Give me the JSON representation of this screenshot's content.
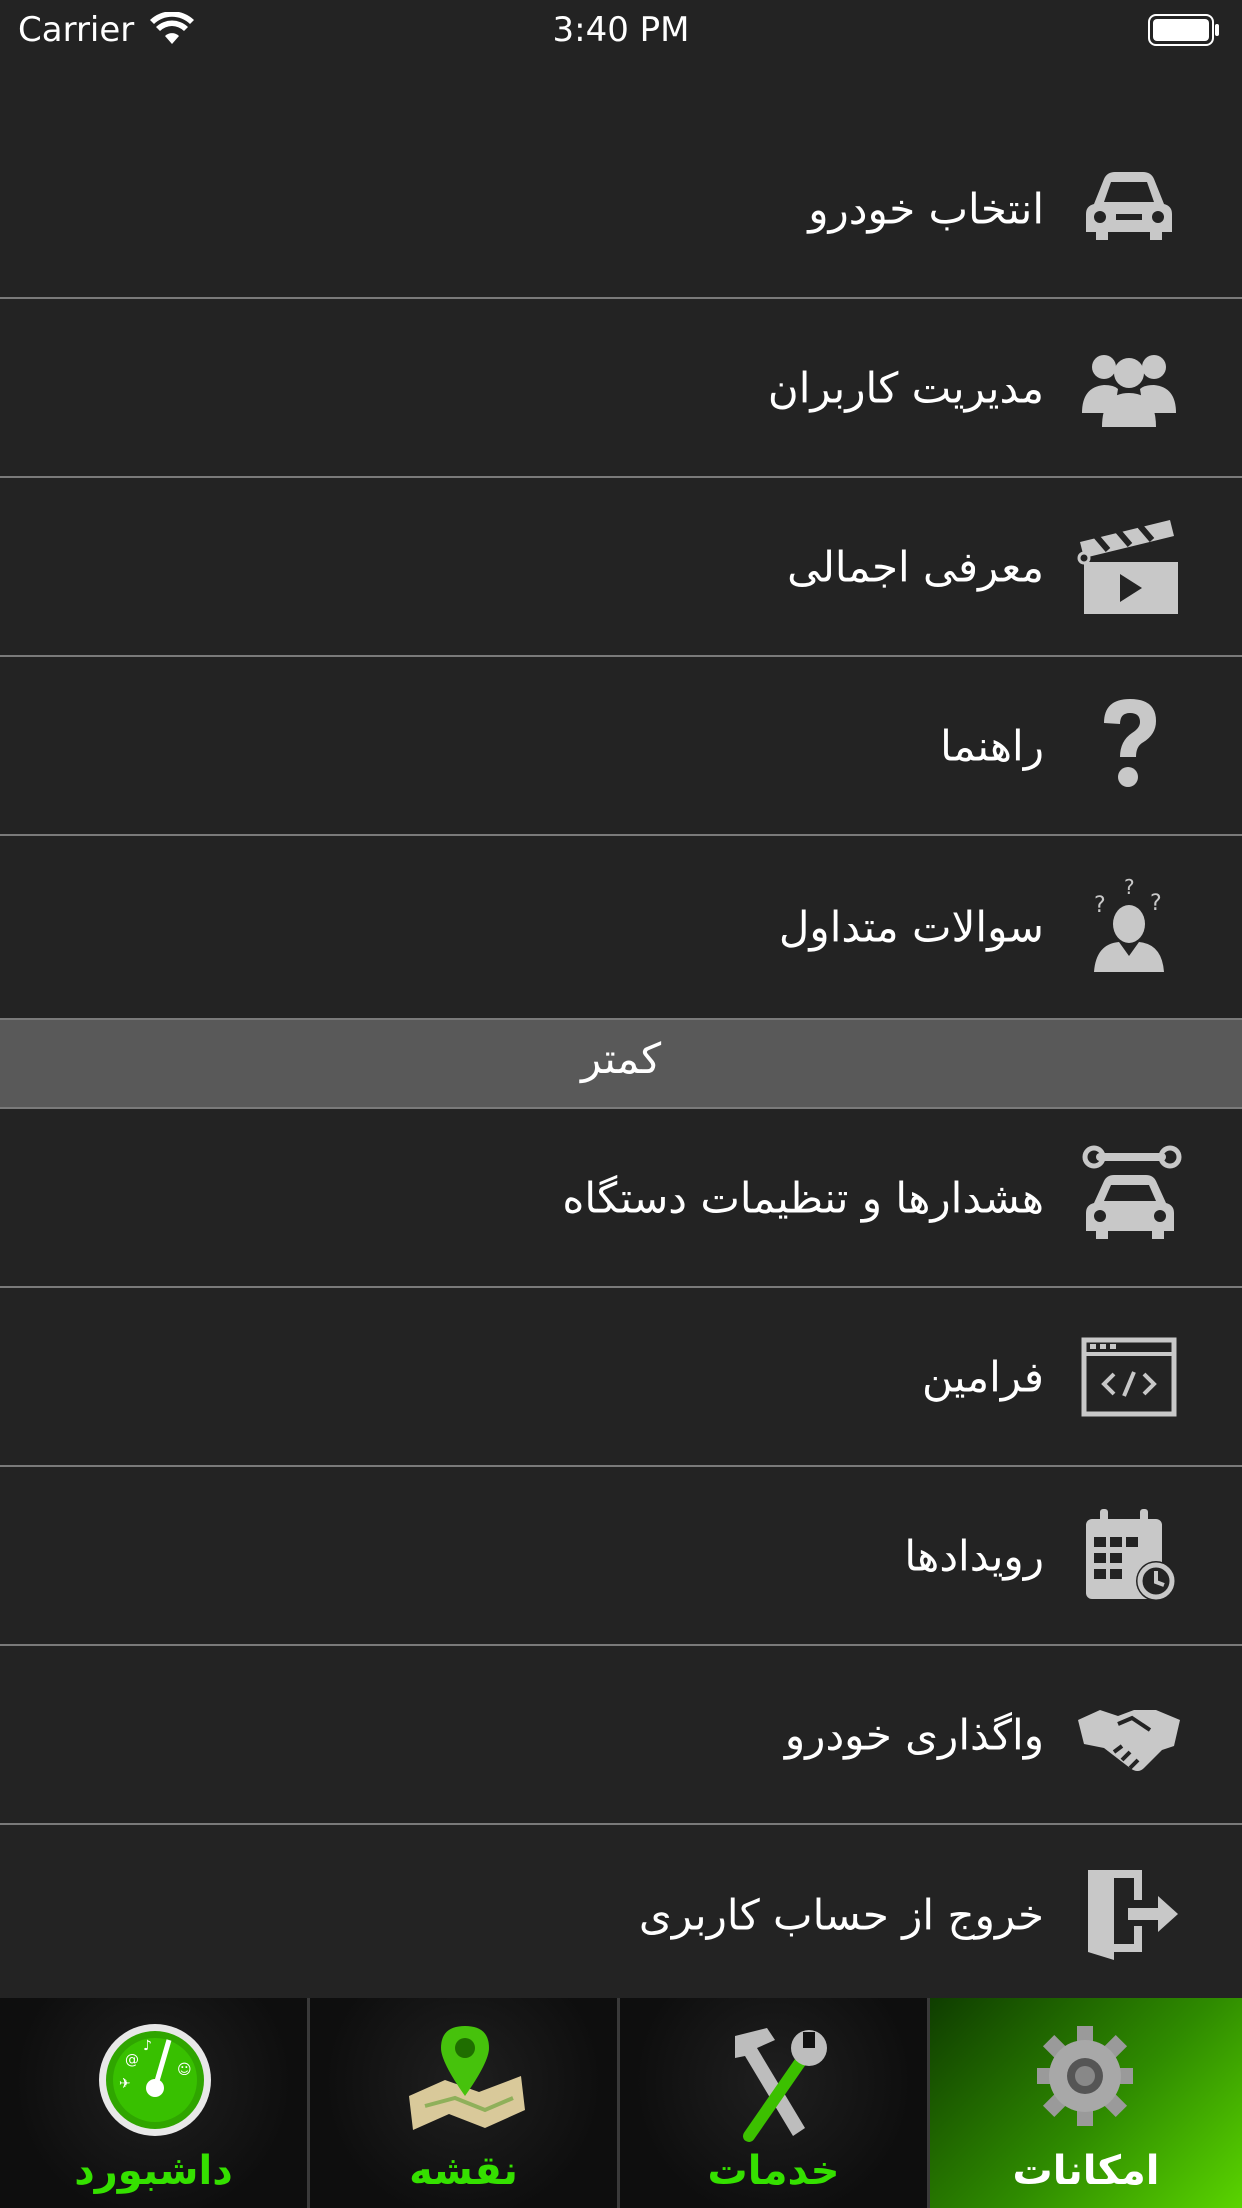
{
  "status_bar": {
    "carrier": "Carrier",
    "time": "3:40 PM"
  },
  "menu": {
    "items": [
      {
        "label": "انتخاب خودرو",
        "icon": "car-icon"
      },
      {
        "label": "مدیریت کاربران",
        "icon": "users-icon"
      },
      {
        "label": "معرفی اجمالی",
        "icon": "clapperboard-icon"
      },
      {
        "label": "راهنما",
        "icon": "question-icon"
      },
      {
        "label": "سوالات متداول",
        "icon": "faq-person-icon"
      }
    ],
    "section_header": "کمتر",
    "more_items": [
      {
        "label": "هشدارها و تنظیمات دستگاه",
        "icon": "car-wrench-icon"
      },
      {
        "label": "فرامین",
        "icon": "code-window-icon"
      },
      {
        "label": "رویدادها",
        "icon": "calendar-clock-icon"
      },
      {
        "label": "واگذاری خودرو",
        "icon": "handshake-icon"
      },
      {
        "label": "خروج از حساب کاربری",
        "icon": "logout-door-icon"
      }
    ]
  },
  "tab_bar": {
    "tabs": [
      {
        "label": "داشبورد",
        "icon": "dashboard-gauge-icon",
        "active": false
      },
      {
        "label": "نقشه",
        "icon": "map-pin-icon",
        "active": false
      },
      {
        "label": "خدمات",
        "icon": "tools-icon",
        "active": false
      },
      {
        "label": "امکانات",
        "icon": "gear-icon",
        "active": true
      }
    ]
  },
  "colors": {
    "background": "#232323",
    "divider": "#7a7a7a",
    "section_header": "#595959",
    "icon_gray": "#c8c8c8",
    "tab_accent": "#35e000"
  }
}
